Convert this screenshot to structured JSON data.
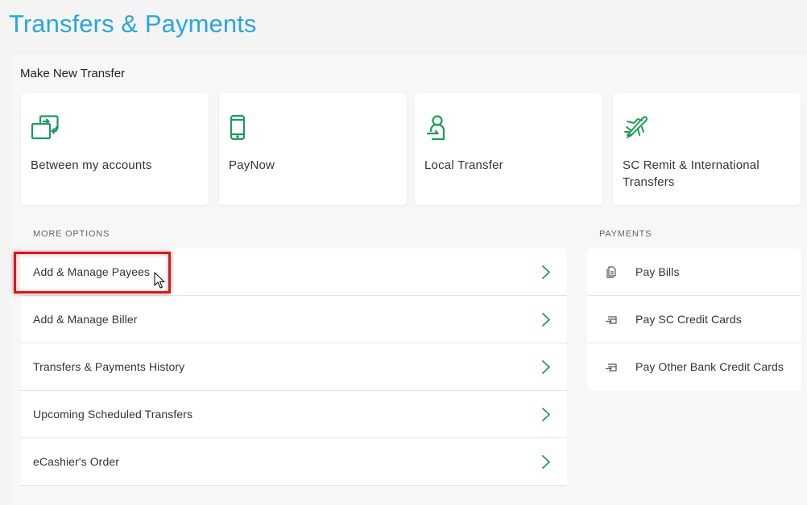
{
  "page": {
    "title": "Transfers & Payments",
    "accent_color": "#2aa6dc",
    "icon_color": "#1e9c5a"
  },
  "make_new_transfer": {
    "heading": "Make New Transfer",
    "cards": [
      {
        "label": "Between my accounts",
        "icon": "transfer-arrows-icon"
      },
      {
        "label": "PayNow",
        "icon": "mobile-phone-icon"
      },
      {
        "label": "Local Transfer",
        "icon": "person-transfer-icon"
      },
      {
        "label": "SC Remit & International Transfers",
        "icon": "airplane-icon"
      }
    ]
  },
  "more_options": {
    "heading": "MORE OPTIONS",
    "items": [
      {
        "label": "Add & Manage Payees",
        "highlighted": true
      },
      {
        "label": "Add & Manage Biller"
      },
      {
        "label": "Transfers & Payments History"
      },
      {
        "label": "Upcoming Scheduled Transfers"
      },
      {
        "label": "eCashier's Order"
      }
    ]
  },
  "payments": {
    "heading": "PAYMENTS",
    "items": [
      {
        "label": "Pay Bills",
        "icon": "bill-document-icon"
      },
      {
        "label": "Pay SC Credit Cards",
        "icon": "credit-card-icon"
      },
      {
        "label": "Pay Other Bank Credit Cards",
        "icon": "credit-card-icon"
      }
    ]
  },
  "annotation": {
    "highlight_color": "#e0141b"
  }
}
